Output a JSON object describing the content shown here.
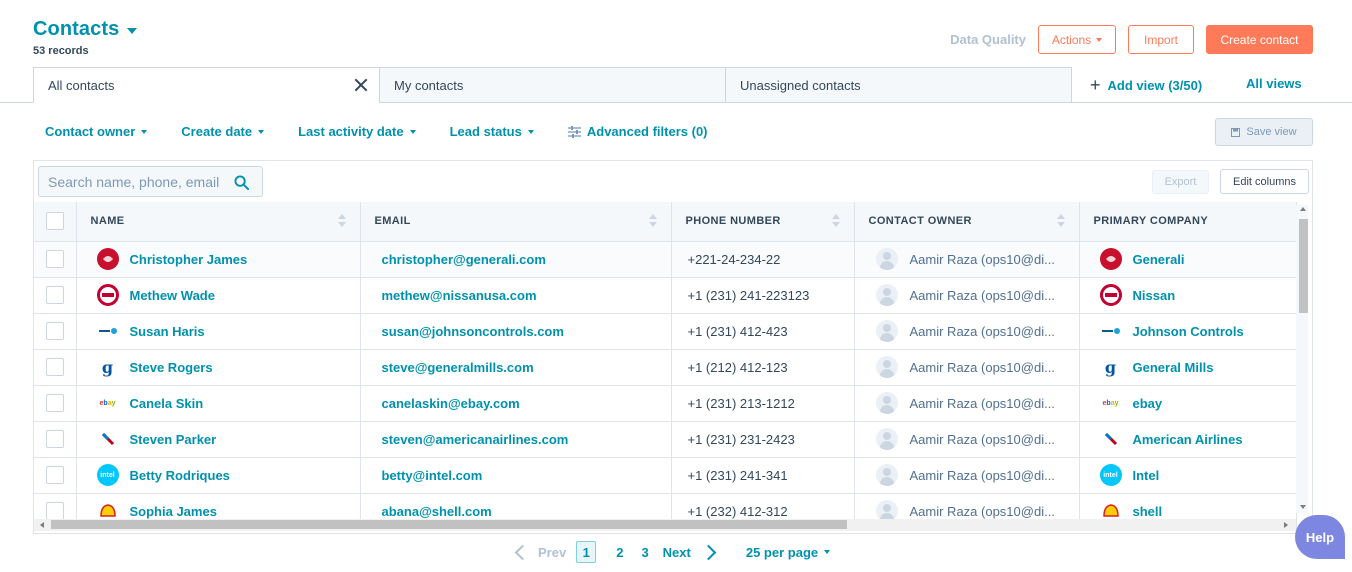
{
  "header": {
    "title": "Contacts",
    "records": "53 records",
    "data_quality": "Data Quality",
    "actions_label": "Actions",
    "import_label": "Import",
    "create_label": "Create contact"
  },
  "tabs": [
    {
      "label": "All contacts"
    },
    {
      "label": "My contacts"
    },
    {
      "label": "Unassigned contacts"
    }
  ],
  "views": {
    "add_view": "Add view (3/50)",
    "all_views": "All views"
  },
  "filters": {
    "contact_owner": "Contact owner",
    "create_date": "Create date",
    "last_activity": "Last activity date",
    "lead_status": "Lead status",
    "advanced": "Advanced filters (0)",
    "save_view": "Save view"
  },
  "table_tools": {
    "search_placeholder": "Search name, phone, email",
    "export": "Export",
    "edit_columns": "Edit columns"
  },
  "columns": [
    "NAME",
    "EMAIL",
    "PHONE NUMBER",
    "CONTACT OWNER",
    "PRIMARY COMPANY"
  ],
  "rows": [
    {
      "name": "Christopher James",
      "email": "christopher@generali.com",
      "phone": "+221-24-234-22",
      "owner": "Aamir Raza (ops10@di...",
      "company": "Generali",
      "logo": "generali"
    },
    {
      "name": "Methew Wade",
      "email": "methew@nissanusa.com",
      "phone": "+1 (231) 241-223123",
      "owner": "Aamir Raza (ops10@di...",
      "company": "Nissan",
      "logo": "nissan"
    },
    {
      "name": "Susan Haris",
      "email": "susan@johnsoncontrols.com",
      "phone": "+1 (231) 412-423",
      "owner": "Aamir Raza (ops10@di...",
      "company": "Johnson Controls",
      "logo": "johnson"
    },
    {
      "name": "Steve Rogers",
      "email": "steve@generalmills.com",
      "phone": "+1 (212) 412-123",
      "owner": "Aamir Raza (ops10@di...",
      "company": "General Mills",
      "logo": "gm"
    },
    {
      "name": "Canela Skin",
      "email": "canelaskin@ebay.com",
      "phone": "+1 (231) 213-1212",
      "owner": "Aamir Raza (ops10@di...",
      "company": "ebay",
      "logo": "ebay"
    },
    {
      "name": "Steven Parker",
      "email": "steven@americanairlines.com",
      "phone": "+1 (231) 231-2423",
      "owner": "Aamir Raza (ops10@di...",
      "company": "American Airlines",
      "logo": "aa"
    },
    {
      "name": "Betty Rodriques",
      "email": "betty@intel.com",
      "phone": "+1 (231) 241-341",
      "owner": "Aamir Raza (ops10@di...",
      "company": "Intel",
      "logo": "intel"
    },
    {
      "name": "Sophia James",
      "email": "abana@shell.com",
      "phone": "+1 (232) 412-312",
      "owner": "Aamir Raza (ops10@di...",
      "company": "shell",
      "logo": "shell"
    }
  ],
  "pagination": {
    "prev": "Prev",
    "pages": [
      "1",
      "2",
      "3"
    ],
    "next": "Next",
    "per_page": "25 per page"
  },
  "help": "Help"
}
